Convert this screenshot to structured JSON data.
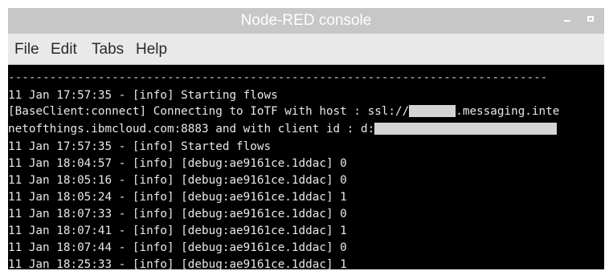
{
  "window": {
    "title": "Node-RED console",
    "minimize_glyph": "",
    "maximize_glyph": ""
  },
  "menu": {
    "items": [
      {
        "label": "File"
      },
      {
        "label": "Edit"
      },
      {
        "label": "Tabs"
      },
      {
        "label": "Help"
      }
    ]
  },
  "terminal": {
    "separator": "------------------------------------------------------------------------------",
    "lines": [
      "11 Jan 17:57:35 - [info] Starting flows",
      "[BaseClient:connect] Connecting to IoTF with host : ssl://",
      ".messaging.inte",
      "netofthings.ibmcloud.com:8883 and with client id : d:",
      "11 Jan 17:57:35 - [info] Started flows",
      "11 Jan 18:04:57 - [info] [debug:ae9161ce.1ddac] 0",
      "11 Jan 18:05:16 - [info] [debug:ae9161ce.1ddac] 0",
      "11 Jan 18:05:24 - [info] [debug:ae9161ce.1ddac] 1",
      "11 Jan 18:07:33 - [info] [debug:ae9161ce.1ddac] 0",
      "11 Jan 18:07:41 - [info] [debug:ae9161ce.1ddac] 1",
      "11 Jan 18:07:44 - [info] [debug:ae9161ce.1ddac] 0",
      "11 Jan 18:25:33 - [info] [debug:ae9161ce.1ddac] 1"
    ]
  },
  "colors": {
    "titlebar_bg": "#c7c7c7",
    "menubar_bg": "#e9e9e9",
    "terminal_bg": "#000000",
    "terminal_fg": "#e8e8e8",
    "redaction": "#d4d4d4"
  }
}
